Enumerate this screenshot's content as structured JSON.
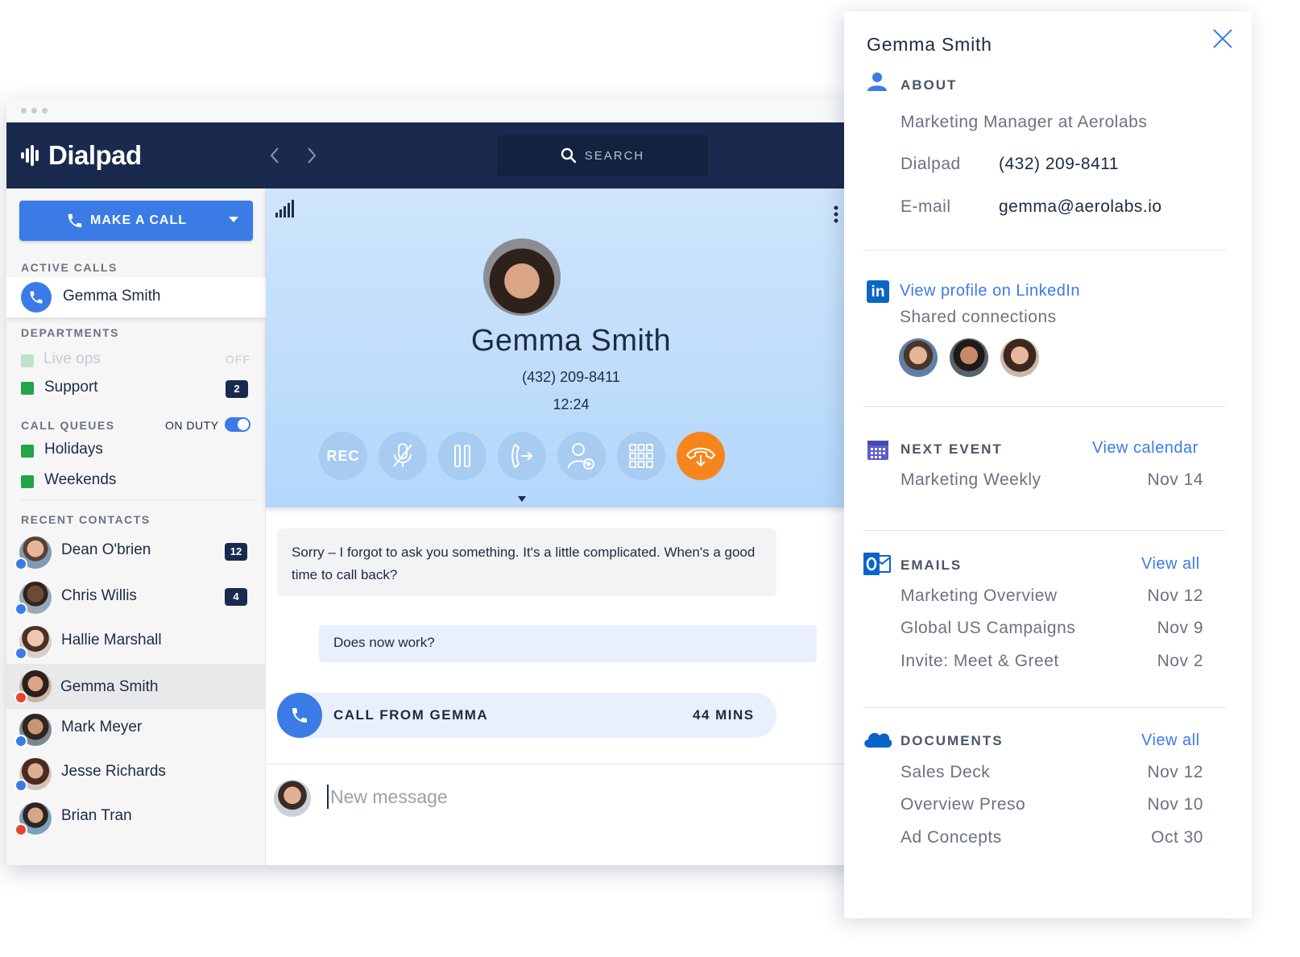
{
  "app": {
    "logo_text": "Dialpad",
    "search_label": "SEARCH"
  },
  "sidebar": {
    "make_call_label": "MAKE A CALL",
    "active_calls_heading": "ACTIVE CALLS",
    "active_call_name": "Gemma Smith",
    "departments_heading": "DEPARTMENTS",
    "departments": [
      {
        "name": "Live ops",
        "status": "OFF",
        "color": "#bfe3c8"
      },
      {
        "name": "Support",
        "badge": "2",
        "color": "#22a447"
      }
    ],
    "call_queues_heading": "CALL QUEUES",
    "on_duty_label": "ON DUTY",
    "queues": [
      {
        "name": "Holidays",
        "color": "#22a447"
      },
      {
        "name": "Weekends",
        "color": "#22a447"
      }
    ],
    "recent_contacts_heading": "RECENT CONTACTS",
    "contacts": [
      {
        "name": "Dean O'brien",
        "badge": "12",
        "status": "blue"
      },
      {
        "name": "Chris Willis",
        "badge": "4",
        "status": "blue"
      },
      {
        "name": "Hallie Marshall",
        "badge": "",
        "status": "blue"
      },
      {
        "name": "Gemma Smith",
        "badge": "",
        "status": "red"
      },
      {
        "name": "Mark Meyer",
        "badge": "",
        "status": "blue"
      },
      {
        "name": "Jesse Richards",
        "badge": "",
        "status": "blue"
      },
      {
        "name": "Brian Tran",
        "badge": "",
        "status": "red"
      }
    ]
  },
  "call": {
    "name": "Gemma Smith",
    "number": "(432) 209-8411",
    "duration": "12:24",
    "rec_label": "REC"
  },
  "messages": {
    "incoming": "Sorry – I forgot to ask you something. It's a little complicated. When's a good time to call back?",
    "outgoing": "Does now work?",
    "call_log_label": "CALL FROM GEMMA",
    "call_log_duration": "44 MINS",
    "composer_placeholder": "New message"
  },
  "panel": {
    "title": "Gemma Smith",
    "about_heading": "ABOUT",
    "job": "Marketing Manager at Aerolabs",
    "dialpad_label": "Dialpad",
    "dialpad_number": "(432) 209-8411",
    "email_label": "E-mail",
    "email_value": "gemma@aerolabs.io",
    "linkedin_link": "View profile on LinkedIn",
    "shared_connections": "Shared connections",
    "next_event_heading": "NEXT EVENT",
    "view_calendar": "View calendar",
    "event_name": "Marketing Weekly",
    "event_date": "Nov 14",
    "emails_heading": "EMAILS",
    "emails_view_all": "View all",
    "emails": [
      {
        "subject": "Marketing Overview",
        "date": "Nov 12"
      },
      {
        "subject": "Global US Campaigns",
        "date": "Nov 9"
      },
      {
        "subject": "Invite: Meet & Greet",
        "date": "Nov 2"
      }
    ],
    "documents_heading": "DOCUMENTS",
    "documents_view_all": "View all",
    "documents": [
      {
        "name": "Sales Deck",
        "date": "Nov 12"
      },
      {
        "name": "Overview Preso",
        "date": "Nov 10"
      },
      {
        "name": "Ad Concepts",
        "date": "Oct 30"
      }
    ]
  },
  "colors": {
    "navy": "#1a2a4e",
    "accent_blue": "#3b7be6",
    "hangup_orange": "#f7851e",
    "green": "#22a447"
  }
}
